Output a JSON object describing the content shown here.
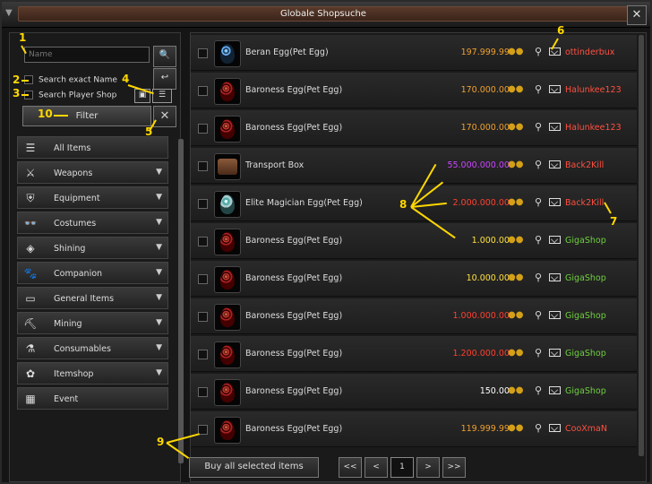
{
  "window": {
    "title": "Globale Shopsuche",
    "close_label": "✕",
    "menu_label": "▼"
  },
  "search": {
    "placeholder": "Name",
    "search_icon": "🔍",
    "back_icon": "↩",
    "exact_name_label": "Search exact Name",
    "player_shop_label": "Search Player Shop",
    "filter_label": "Filter",
    "clear_icon": "✕",
    "save_icon": "▣",
    "list_icon": "☰"
  },
  "categories": [
    {
      "label": "All Items",
      "icon": "☰",
      "has_chevron": false
    },
    {
      "label": "Weapons",
      "icon": "⚔",
      "has_chevron": true
    },
    {
      "label": "Equipment",
      "icon": "⛨",
      "has_chevron": true
    },
    {
      "label": "Costumes",
      "icon": "👓",
      "has_chevron": true
    },
    {
      "label": "Shining",
      "icon": "◈",
      "has_chevron": true
    },
    {
      "label": "Companion",
      "icon": "🐾",
      "has_chevron": true
    },
    {
      "label": "General Items",
      "icon": "▭",
      "has_chevron": true
    },
    {
      "label": "Mining",
      "icon": "⛏",
      "has_chevron": true
    },
    {
      "label": "Consumables",
      "icon": "⚗",
      "has_chevron": true
    },
    {
      "label": "Itemshop",
      "icon": "✿",
      "has_chevron": true
    },
    {
      "label": "Event",
      "icon": "▦",
      "has_chevron": false
    }
  ],
  "listings": [
    {
      "name": "Beran Egg(Pet Egg)",
      "price": "197.999.990",
      "price_color": "#f0a030",
      "seller": "ottinderbux",
      "seller_color": "#ff5040",
      "thumb": "blue"
    },
    {
      "name": "Baroness Egg(Pet Egg)",
      "price": "170.000.000",
      "price_color": "#f0a030",
      "seller": "Halunkee123",
      "seller_color": "#ff5040",
      "thumb": "red"
    },
    {
      "name": "Baroness Egg(Pet Egg)",
      "price": "170.000.000",
      "price_color": "#f0a030",
      "seller": "Halunkee123",
      "seller_color": "#ff5040",
      "thumb": "red"
    },
    {
      "name": "Transport Box",
      "price": "55.000.000.000",
      "price_color": "#cc44ff",
      "seller": "Back2Kill",
      "seller_color": "#ff5040",
      "thumb": "box"
    },
    {
      "name": "Elite Magician Egg(Pet Egg)",
      "price": "2.000.000.000",
      "price_color": "#ff4030",
      "seller": "Back2Kill",
      "seller_color": "#ff5040",
      "thumb": "teal"
    },
    {
      "name": "Baroness Egg(Pet Egg)",
      "price": "1.000.000",
      "price_color": "#ffe040",
      "seller": "GigaShop",
      "seller_color": "#6fcf3f",
      "thumb": "red"
    },
    {
      "name": "Baroness Egg(Pet Egg)",
      "price": "10.000.001",
      "price_color": "#ffe040",
      "seller": "GigaShop",
      "seller_color": "#6fcf3f",
      "thumb": "red"
    },
    {
      "name": "Baroness Egg(Pet Egg)",
      "price": "1.000.000.000",
      "price_color": "#ff4030",
      "seller": "GigaShop",
      "seller_color": "#6fcf3f",
      "thumb": "red"
    },
    {
      "name": "Baroness Egg(Pet Egg)",
      "price": "1.200.000.000",
      "price_color": "#ff4030",
      "seller": "GigaShop",
      "seller_color": "#6fcf3f",
      "thumb": "red"
    },
    {
      "name": "Baroness Egg(Pet Egg)",
      "price": "150.000",
      "price_color": "#ffffff",
      "seller": "GigaShop",
      "seller_color": "#6fcf3f",
      "thumb": "red"
    },
    {
      "name": "Baroness Egg(Pet Egg)",
      "price": "119.999.999",
      "price_color": "#f0a030",
      "seller": "CooXmaN",
      "seller_color": "#ff5040",
      "thumb": "red"
    }
  ],
  "footer": {
    "buy_label": "Buy all selected items",
    "first_label": "<<",
    "prev_label": "<",
    "page_label": "1",
    "next_label": ">",
    "last_label": ">>"
  },
  "annotations": [
    "1",
    "2",
    "3",
    "4",
    "5",
    "6",
    "7",
    "8",
    "9",
    "10"
  ]
}
